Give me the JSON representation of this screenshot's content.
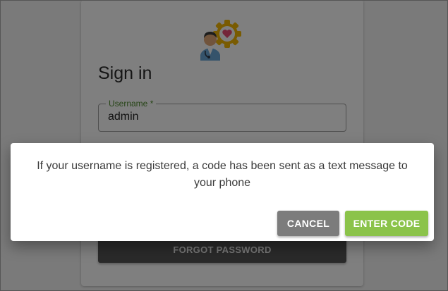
{
  "login": {
    "title": "Sign in",
    "username_label": "Username *",
    "username_value": "admin",
    "forgot_password_label": "FORGOT PASSWORD",
    "logo_icon": "doctor-heart-gear-icon"
  },
  "dialog": {
    "message": "If your username is registered, a code has been sent as a text message to your phone",
    "cancel_label": "CANCEL",
    "enter_code_label": "ENTER CODE"
  },
  "colors": {
    "primary": "#8bc34a",
    "label_green": "#4f8a2e",
    "cancel_gray": "#7c7c7c",
    "dark_button": "#555555",
    "gear_gold": "#f2b705",
    "heart_pink": "#e84a73"
  }
}
